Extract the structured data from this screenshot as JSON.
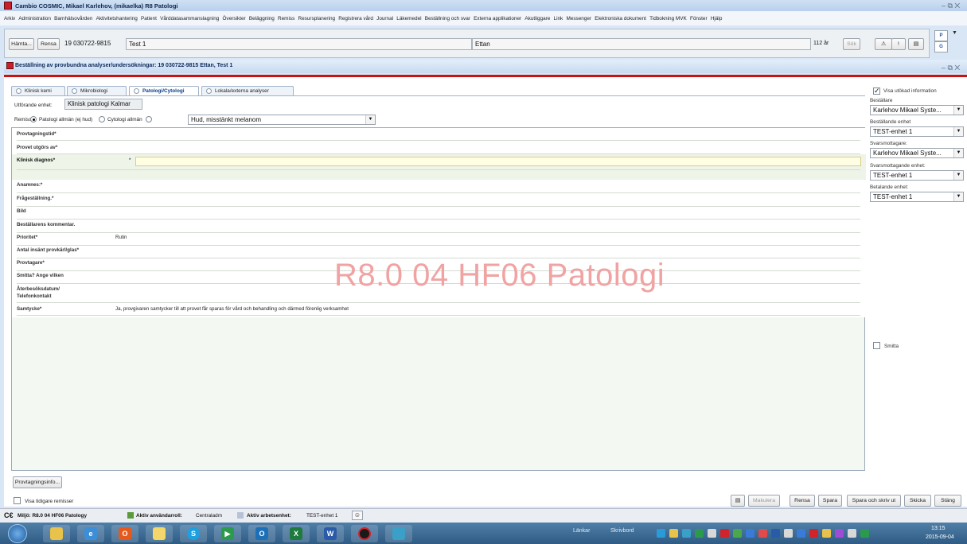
{
  "window": {
    "title": "Cambio COSMIC, Mikael Karlehov, (mikaelka) R8 Patologi",
    "controls": "– ⧉ ✕"
  },
  "menu": [
    "Arkiv",
    "Administration",
    "Barnhälsovården",
    "Aktivitetshantering",
    "Patient",
    "Vårddatasammanslagning",
    "Översikter",
    "Beläggning",
    "Remiss",
    "Resursplanering",
    "Registrera vård",
    "Journal",
    "Läkemedel",
    "Beställning och svar",
    "Externa applikationer",
    "Akutliggare",
    "Link",
    "Messenger",
    "Elektroniska dokument",
    "Tidbokning MVK",
    "Fönster",
    "Hjälp"
  ],
  "patient_bar": {
    "fetch_label": "Hämta...",
    "clear_label": "Rensa",
    "pnr": "19 030722-9815",
    "firstname": "Test 1",
    "lastname": "Ettan",
    "age": "112 år",
    "search_label": "Sök",
    "p_label": "P",
    "g_label": "G"
  },
  "order_window": {
    "title": "Beställning av provbundna analyser/undersökningar: 19 030722-9815 Ettan, Test 1",
    "controls": "– ⧉ ✕"
  },
  "tabs": [
    "Klinisk kemi",
    "Mikrobiologi",
    "Patologi/Cytologi",
    "Lokala/externa analyser"
  ],
  "active_tab": 2,
  "form": {
    "unit_label": "Utförande enhet:",
    "unit_value": "Klinisk patologi Kalmar",
    "remiss_label": "Remiss:",
    "radio_options": [
      "Patologi allmän (ej hud)",
      "Cytologi allmän",
      ""
    ],
    "radio_selected": 0,
    "remiss_dropdown": "Hud, misstänkt melanom",
    "fields": [
      {
        "label": "Provtagningstid*",
        "value": ""
      },
      {
        "label": "Provet utgörs av*",
        "value": ""
      },
      {
        "label": "Klinisk diagnos*",
        "value": "*"
      },
      {
        "label": "Anamnes:*",
        "value": ""
      },
      {
        "label": "Frågeställning.*",
        "value": ""
      },
      {
        "label": "Bild",
        "value": ""
      },
      {
        "label": "Beställarens kommentar.",
        "value": ""
      },
      {
        "label": "Prioritet*",
        "value": "Rutin"
      },
      {
        "label": "Antal insänt provkärl/glas*",
        "value": ""
      },
      {
        "label": "Provtagare*",
        "value": ""
      },
      {
        "label": "Smitta? Ange vilken",
        "value": ""
      },
      {
        "label": "Återbesöksdatum/\nTelefonkontakt",
        "value": ""
      },
      {
        "label": "Samtycke*",
        "value": "Ja, provgivaren samtycker till att provet får sparas för vård och behandling och därmed förenlig verksamhet"
      }
    ],
    "watermark": "R8.0 04 HF06 Patologi",
    "provtagning_btn": "Provtagningsinfo..."
  },
  "right_panel": {
    "extended_info_label": "Visa utökad information",
    "bestallare_label": "Beställare",
    "bestallare_value": "Karlehov Mikael Syste...",
    "best_enhet_label": "Beställande enhet",
    "best_enhet_value": "TEST-enhet 1",
    "svarsmottagare_label": "Svarsmottagare:",
    "svarsmottagare_value": "Karlehov Mikael Syste...",
    "svarsmott_enhet_label": "Svarsmottagande enhet:",
    "svarsmott_enhet_value": "TEST-enhet 1",
    "betalande_label": "Betalande enhet:",
    "betalande_value": "TEST-enhet 1",
    "smitta_label": "Smitta"
  },
  "bottom": {
    "show_prev_label": "Visa tidigare remisser",
    "buttons": [
      "Makulera",
      "Rensa",
      "Spara",
      "Spara och skriv ut",
      "Skicka",
      "Stäng"
    ]
  },
  "status": {
    "ce": "C€",
    "env": "Miljö: R8.0 04 HF06 Patology",
    "role_label": "Aktiv användarroll:",
    "role_value": "Centraladm",
    "unit_label": "Aktiv arbetsenhet:",
    "unit_value": "TEST-enhet 1"
  },
  "taskbar": {
    "links": "Länkar",
    "desktop": "Skrivbord",
    "time": "13:15",
    "date": "2015-09-04"
  }
}
